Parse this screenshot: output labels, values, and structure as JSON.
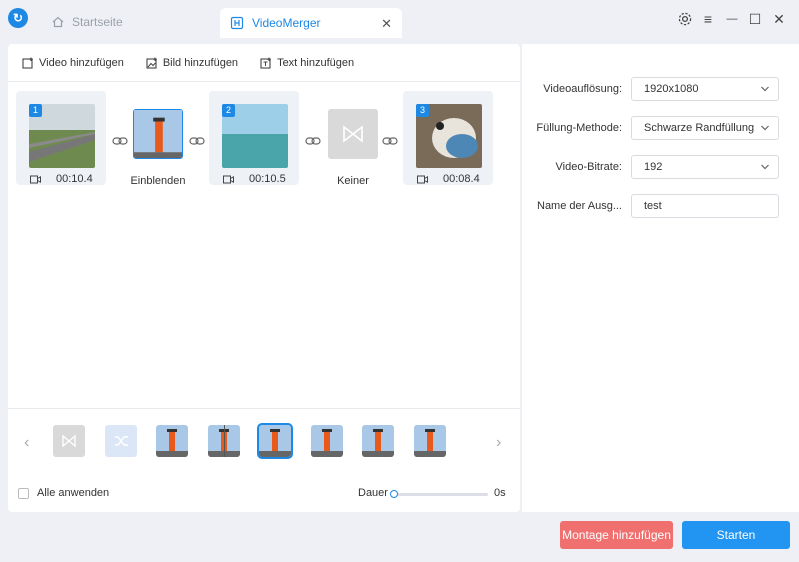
{
  "app": {
    "logo_glyph": "↻",
    "accent": "#1e88e5"
  },
  "tabs": {
    "home": "Startseite",
    "active": "VideoMerger",
    "close": "✕"
  },
  "window": {
    "settings_icon": "gear-icon",
    "menu": "≡",
    "minimize": "—",
    "maximize": "☐",
    "close": "✕"
  },
  "toolbar": {
    "add_video": "Video hinzufügen",
    "add_image": "Bild hinzufügen",
    "add_text": "Text hinzufügen"
  },
  "clips": [
    {
      "number": "1",
      "duration": "00:10.4"
    },
    {
      "number": "2",
      "duration": "00:10.5"
    },
    {
      "number": "3",
      "duration": "00:08.4"
    }
  ],
  "transitions": [
    {
      "label": "Einblenden"
    },
    {
      "label": "Keiner"
    }
  ],
  "strip": {
    "prev": "‹",
    "next": "›"
  },
  "apply_all": {
    "label": "Alle anwenden",
    "checked": false
  },
  "duration": {
    "label": "Dauer",
    "value": "0s",
    "level": 0
  },
  "settings": {
    "resolution": {
      "label": "Videoauflösung:",
      "value": "1920x1080"
    },
    "fill": {
      "label": "Füllung-Methode:",
      "value": "Schwarze Randfüllung"
    },
    "bitrate": {
      "label": "Video-Bitrate:",
      "value": "192"
    },
    "output_name": {
      "label": "Name der Ausg...",
      "value": "test"
    }
  },
  "buttons": {
    "montage": "Montage hinzufügen",
    "start": "Starten"
  },
  "colors": {
    "montage": "#f07070",
    "start": "#2294f2"
  }
}
